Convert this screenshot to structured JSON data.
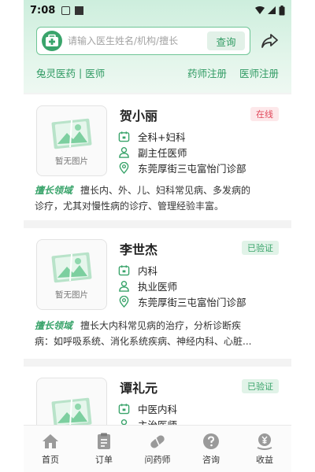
{
  "status_bar": {
    "time": "7:08"
  },
  "search": {
    "placeholder": "请输入医生姓名/机构/擅长",
    "button_label": "查询"
  },
  "subnav": {
    "brand": "兔灵医药",
    "section": "医师",
    "links": [
      "药师注册",
      "医师注册"
    ]
  },
  "doctors": [
    {
      "name": "贺小丽",
      "badge": "在线",
      "department": "全科+妇科",
      "title": "副主任医师",
      "clinic": "东莞厚街三屯富怡门诊部",
      "photo_text": "暂无图片",
      "specialty_tag": "擅长领域",
      "specialty_line1": "擅长内、外、儿、妇科常见病、多发病的",
      "specialty_line2": "诊疗，尤其对慢性病的诊疗、管理经验丰富。"
    },
    {
      "name": "李世杰",
      "badge": "已验证",
      "department": "内科",
      "title": "执业医师",
      "clinic": "东莞厚街三屯富怡门诊部",
      "photo_text": "暂无图片",
      "specialty_tag": "擅长领域",
      "specialty_line1": "擅长大内科常见病的治疗，分析诊断疾",
      "specialty_line2": "病：如呼吸系统、消化系统疾病、神经内科、心脏..."
    },
    {
      "name": "谭礼元",
      "badge": "已验证",
      "department": "中医内科",
      "title": "主治医师"
    }
  ],
  "tabbar": [
    {
      "label": "首页",
      "icon": "home-icon"
    },
    {
      "label": "订单",
      "icon": "order-icon"
    },
    {
      "label": "问药师",
      "icon": "pill-icon"
    },
    {
      "label": "咨询",
      "icon": "question-icon"
    },
    {
      "label": "收益",
      "icon": "income-icon"
    }
  ],
  "colors": {
    "accent": "#2f9a62",
    "online_badge": "#e0485a",
    "verified_badge": "#3aa46b"
  }
}
